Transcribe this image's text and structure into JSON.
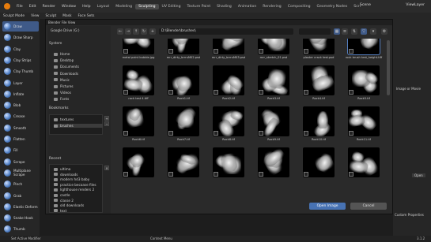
{
  "topbar": {
    "menus": [
      "File",
      "Edit",
      "Render",
      "Window",
      "Help"
    ],
    "workspaces": [
      "Layout",
      "Modeling",
      "Sculpting",
      "UV Editing",
      "Texture Paint",
      "Shading",
      "Animation",
      "Rendering",
      "Compositing",
      "Geometry Nodes",
      "Scri"
    ],
    "active_workspace": "Sculpting",
    "scene": "Scene",
    "view_layer": "ViewLayer"
  },
  "header2": {
    "mode": "Sculpt Mode",
    "items": [
      "View",
      "Sculpt",
      "Mask",
      "Face Sets"
    ]
  },
  "tools": [
    "Draw",
    "Draw Sharp",
    "Clay",
    "Clay Strips",
    "Clay Thumb",
    "Layer",
    "Inflate",
    "Blob",
    "Crease",
    "Smooth",
    "Flatten",
    "Fill",
    "Scrape",
    "Multiplane Scrape",
    "Pinch",
    "Grab",
    "Elastic Deform",
    "Snake Hook",
    "Thumb"
  ],
  "active_tool": "Draw",
  "dialog": {
    "title": "Blender File View",
    "path": "D:\\Blender\\brushes\\",
    "open_label": "Open Image",
    "cancel_label": "Cancel"
  },
  "sidebar": {
    "drive": "Google Drive (G:)",
    "system_label": "System",
    "system": [
      "Home",
      "Desktop",
      "Documents",
      "Downloads",
      "Music",
      "Pictures",
      "Videos",
      "Fonts"
    ],
    "bookmarks_label": "Bookmarks",
    "bookmarks": [
      "textures",
      "brushes"
    ],
    "recent_label": "Recent",
    "recent": [
      "ultima",
      "downloads",
      "modern hd3 baby",
      "practice becoase files",
      "lighthouse renders 2",
      "castle",
      "classe 2",
      "old downloads",
      "text"
    ]
  },
  "files": [
    "metal paint bubble.jpg",
    "mrr_dirty_brrruM02.psd",
    "mrr_dirty_brrruM03.psd",
    "mrr_stretch_01.psd",
    "plaster crack test.psd",
    "rock brush test_height.tiff",
    "rock test 4.tiff",
    "Rock1.tif",
    "Rock2.tif",
    "Rock3.tif",
    "Rock4.tif",
    "Rock5.tif",
    "Rock6.tif",
    "Rock7.tif",
    "Rock8.tif",
    "Rock9.tif",
    "Rock10.tif",
    "Rock11.tif",
    "",
    "",
    "",
    "",
    "",
    ""
  ],
  "right_panel": {
    "top_label": "Image or Movie",
    "custom_props": "Custom Properties",
    "open_label": "Open"
  },
  "status": {
    "left": "Set Active Modifier",
    "mid": "Context Menu",
    "right": "3.1.2"
  }
}
